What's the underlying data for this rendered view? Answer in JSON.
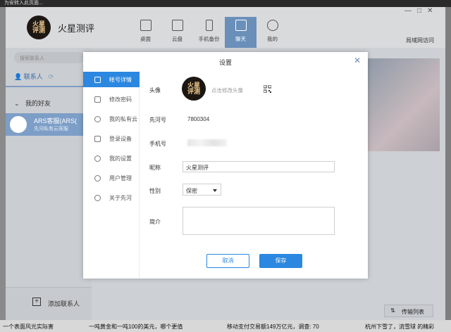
{
  "desktop": {
    "top_text": "为安转入此页面...",
    "bottom_items": [
      "一个表面风光实际害",
      "一吨黄金和一吨100的美元，哪个更值",
      "移动支付交易额149万亿元，调查: 70",
      "杭州下雪了，流雪球 的精彩"
    ]
  },
  "app": {
    "name": "火星测评",
    "logo_text": "火星\n评测",
    "nav": [
      {
        "label": "桌面",
        "icon": "desktop-icon"
      },
      {
        "label": "云盘",
        "icon": "cloud-disk-icon"
      },
      {
        "label": "手机备份",
        "icon": "phone-icon"
      },
      {
        "label": "聊天",
        "icon": "chat-icon",
        "active": true
      },
      {
        "label": "我的",
        "icon": "user-icon"
      }
    ],
    "window_controls": [
      "—",
      "□",
      "✕"
    ],
    "lan_access": "局域网访问",
    "search_placeholder": "搜索联系人",
    "contacts_tab": "联系人",
    "friends_group": "我的好友",
    "contact": {
      "name": "ARS客服(ARS(",
      "subtitle": "先河私有云客服"
    },
    "add_contact": "添加联系人",
    "transfer_list": "传输列表"
  },
  "dialog": {
    "title": "设置",
    "menu": [
      {
        "label": "帐号详情",
        "icon": "account-icon",
        "active": true
      },
      {
        "label": "修改密码",
        "icon": "lock-icon"
      },
      {
        "label": "我的私有云",
        "icon": "cloud-icon"
      },
      {
        "label": "登录设备",
        "icon": "device-icon"
      },
      {
        "label": "我的设置",
        "icon": "settings-icon"
      },
      {
        "label": "用户管理",
        "icon": "users-icon"
      },
      {
        "label": "关于先河",
        "icon": "info-icon"
      }
    ],
    "labels": {
      "avatar": "头像",
      "xianhe_id": "先河号",
      "phone": "手机号",
      "nickname": "昵称",
      "gender": "性别",
      "bio": "简介"
    },
    "avatar_logo_text": "火星\n评测",
    "change_avatar": "点击修改头像",
    "xianhe_id_value": "7800304",
    "nickname_value": "火星测评",
    "gender_value": "保密",
    "bio_value": "",
    "cancel": "取消",
    "save": "保存"
  }
}
